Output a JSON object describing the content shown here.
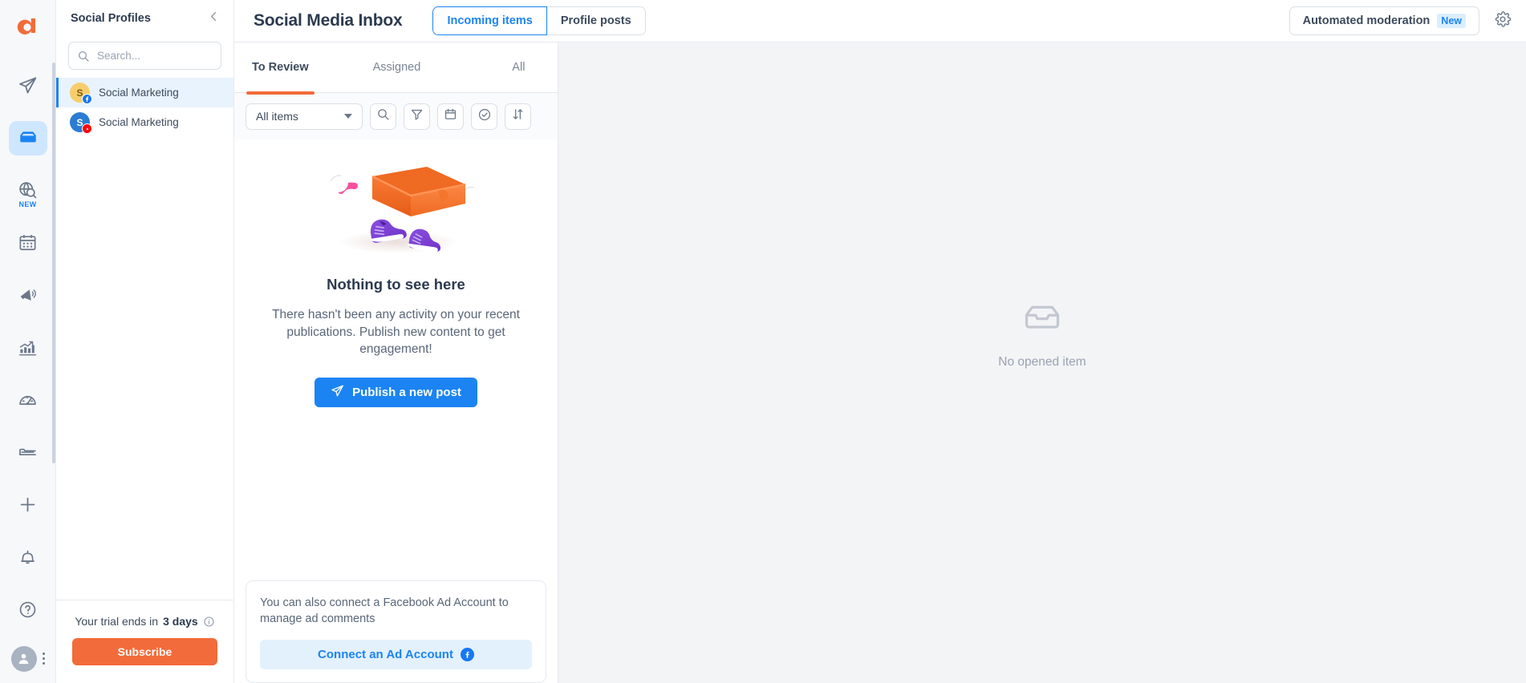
{
  "brand": {
    "logo_letter": "a",
    "accent_orange": "#f26b3a",
    "accent_blue": "#1b84f2"
  },
  "rail": {
    "items": [
      {
        "name": "publish",
        "icon": "paper-plane-icon",
        "active": false,
        "badge": ""
      },
      {
        "name": "inbox",
        "icon": "inbox-icon",
        "active": true,
        "badge": ""
      },
      {
        "name": "listening",
        "icon": "globe-search-icon",
        "active": false,
        "badge": "NEW"
      },
      {
        "name": "calendar",
        "icon": "calendar-icon",
        "active": false,
        "badge": ""
      },
      {
        "name": "campaigns",
        "icon": "megaphone-icon",
        "active": false,
        "badge": ""
      },
      {
        "name": "analytics",
        "icon": "bar-chart-icon",
        "active": false,
        "badge": ""
      },
      {
        "name": "monitoring",
        "icon": "speedometer-icon",
        "active": false,
        "badge": ""
      },
      {
        "name": "library",
        "icon": "folder-icon",
        "active": false,
        "badge": ""
      },
      {
        "name": "add",
        "icon": "plus-icon",
        "active": false,
        "badge": ""
      },
      {
        "name": "notifications",
        "icon": "bell-icon",
        "active": false,
        "badge": ""
      },
      {
        "name": "help",
        "icon": "question-circle-icon",
        "active": false,
        "badge": ""
      }
    ]
  },
  "sidebar": {
    "title": "Social Profiles",
    "collapse_icon": "chevron-left-icon",
    "search": {
      "placeholder": "Search...",
      "value": "",
      "icon": "search-icon"
    },
    "profiles": [
      {
        "name": "Social Marketing",
        "initial": "S",
        "avatar_color": "yellow",
        "network": "facebook",
        "selected": true
      },
      {
        "name": "Social Marketing",
        "initial": "S",
        "avatar_color": "blue",
        "network": "youtube",
        "selected": false
      }
    ],
    "trial": {
      "prefix": "Your trial ends in",
      "days": "3 days",
      "info_icon": "info-icon",
      "subscribe_label": "Subscribe"
    }
  },
  "header": {
    "title": "Social Media Inbox",
    "segments": [
      {
        "label": "Incoming items",
        "active": true
      },
      {
        "label": "Profile posts",
        "active": false
      }
    ],
    "automated_moderation": {
      "label": "Automated moderation",
      "badge": "New"
    },
    "settings_icon": "gear-icon"
  },
  "inbox": {
    "tabs": [
      {
        "label": "To Review",
        "active": true
      },
      {
        "label": "Assigned",
        "active": false
      },
      {
        "label": "All",
        "active": false
      }
    ],
    "toolbar": {
      "filter_select_value": "All items",
      "buttons": [
        {
          "name": "search-button",
          "icon": "search-icon"
        },
        {
          "name": "filter-button",
          "icon": "funnel-icon"
        },
        {
          "name": "date-button",
          "icon": "calendar-icon"
        },
        {
          "name": "status-button",
          "icon": "check-circle-icon"
        },
        {
          "name": "sort-button",
          "icon": "sort-arrows-icon"
        }
      ]
    },
    "empty_state": {
      "illustration": "inbox-tray-character-illustration",
      "title": "Nothing to see here",
      "description": "There hasn't been any activity on your recent publications. Publish new content to get engagement!",
      "cta_label": "Publish a new post",
      "cta_icon": "paper-plane-icon"
    },
    "ad_card": {
      "text": "You can also connect a Facebook Ad Account to manage ad comments",
      "button_label": "Connect an Ad Account",
      "button_icon": "facebook-icon"
    }
  },
  "detail": {
    "icon": "inbox-outline-icon",
    "empty_text": "No opened item"
  }
}
